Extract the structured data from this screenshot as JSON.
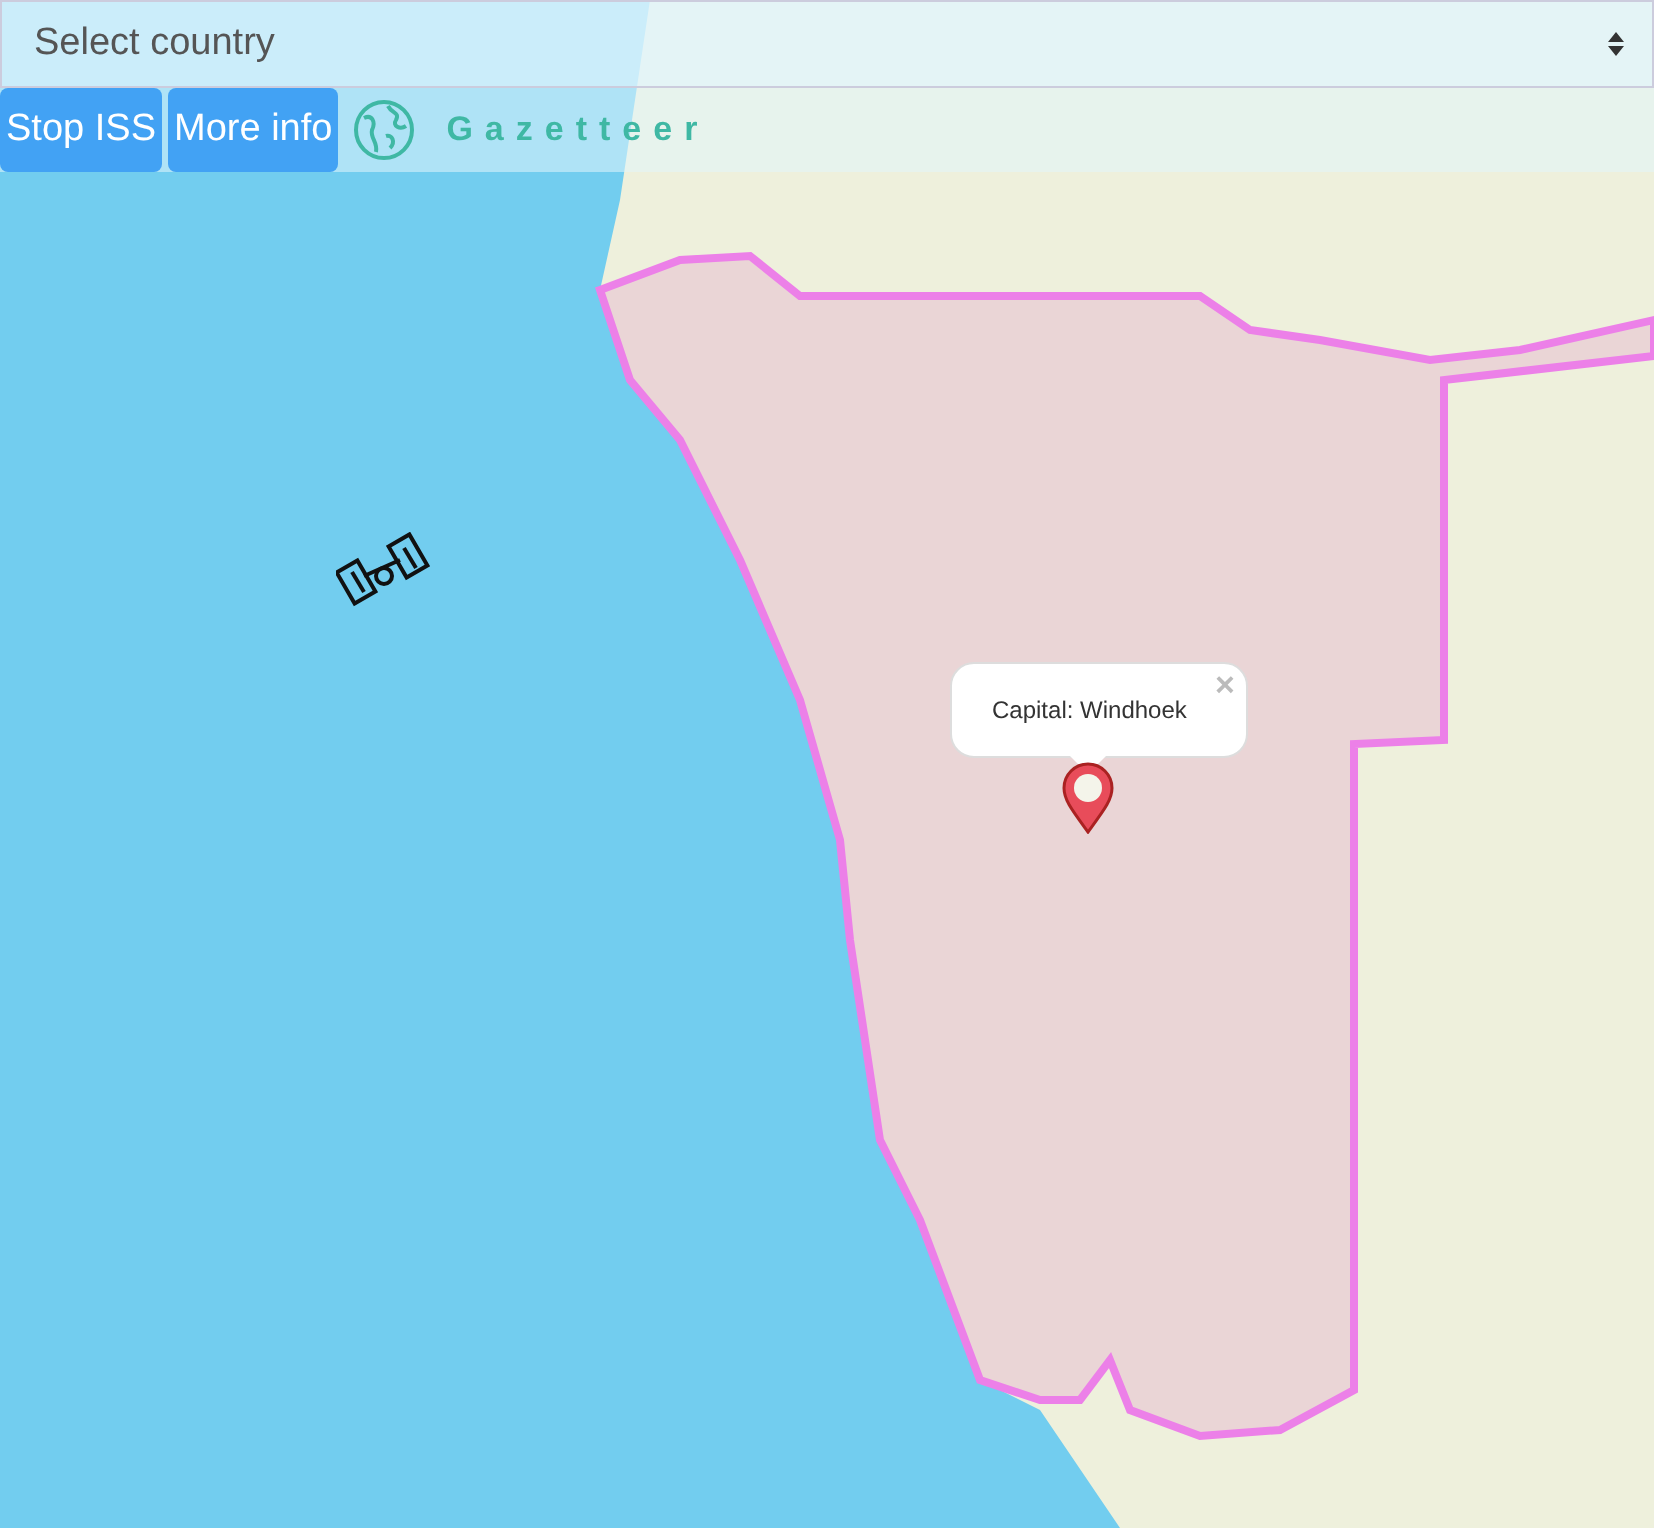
{
  "country_select": {
    "placeholder": "Select country"
  },
  "buttons": [
    {
      "label": "Stop ISS"
    },
    {
      "label": "More info"
    }
  ],
  "brand": {
    "title": "Gazetteer"
  },
  "popup": {
    "text": "Capital: Windhoek",
    "close": "×"
  }
}
